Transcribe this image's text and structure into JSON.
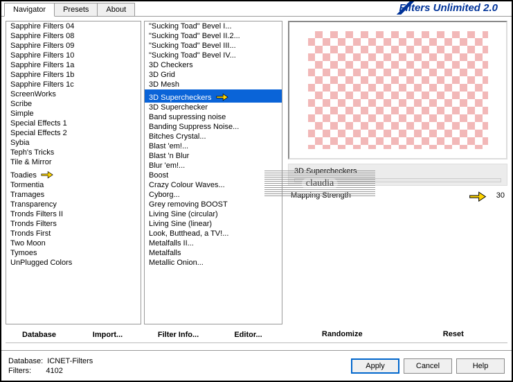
{
  "brand": "Filters Unlimited 2.0",
  "tabs": [
    {
      "label": "Navigator",
      "active": true
    },
    {
      "label": "Presets",
      "active": false
    },
    {
      "label": "About",
      "active": false
    }
  ],
  "categories": [
    "Sapphire Filters 04",
    "Sapphire Filters 08",
    "Sapphire Filters 09",
    "Sapphire Filters 10",
    "Sapphire Filters 1a",
    "Sapphire Filters 1b",
    "Sapphire Filters 1c",
    "ScreenWorks",
    "Scribe",
    "Simple",
    "Special Effects 1",
    "Special Effects 2",
    "Sybia",
    "Teph's Tricks",
    "Tile & Mirror",
    "Toadies",
    "Tormentia",
    "Tramages",
    "Transparency",
    "Tronds Filters II",
    "Tronds Filters",
    "Tronds First",
    "Two Moon",
    "Tymoes",
    "UnPlugged Colors"
  ],
  "category_selected": "Toadies",
  "filters": [
    "\"Sucking Toad\" Bevel I...",
    "\"Sucking Toad\" Bevel II.2...",
    "\"Sucking Toad\" Bevel III...",
    "\"Sucking Toad\" Bevel IV...",
    "3D Checkers",
    "3D Grid",
    "3D Mesh",
    "3D Supercheckers",
    "3D Superchecker",
    "Band supressing noise",
    "Banding Suppress Noise...",
    "Bitches Crystal...",
    "Blast 'em!...",
    "Blast 'n Blur",
    "Blur 'em!...",
    "Boost",
    "Crazy Colour Waves...",
    "Cyborg...",
    "Grey removing BOOST",
    "Living Sine (circular)",
    "Living Sine (linear)",
    "Look, Butthead, a TV!...",
    "Metalfalls II...",
    "Metalfalls",
    "Metallic Onion..."
  ],
  "filter_selected": "3D Supercheckers",
  "col1_buttons": [
    "Database",
    "Import..."
  ],
  "col2_buttons": [
    "Filter Info...",
    "Editor..."
  ],
  "col3_buttons": [
    "Randomize",
    "Reset"
  ],
  "preview_title": "3D Supercheckers",
  "param": {
    "label": "Mapping Strength",
    "value": "30"
  },
  "footer": {
    "db_label": "Database:",
    "db_value": "ICNET-Filters",
    "count_label": "Filters:",
    "count_value": "4102",
    "apply": "Apply",
    "cancel": "Cancel",
    "help": "Help"
  },
  "watermark": "claudia"
}
